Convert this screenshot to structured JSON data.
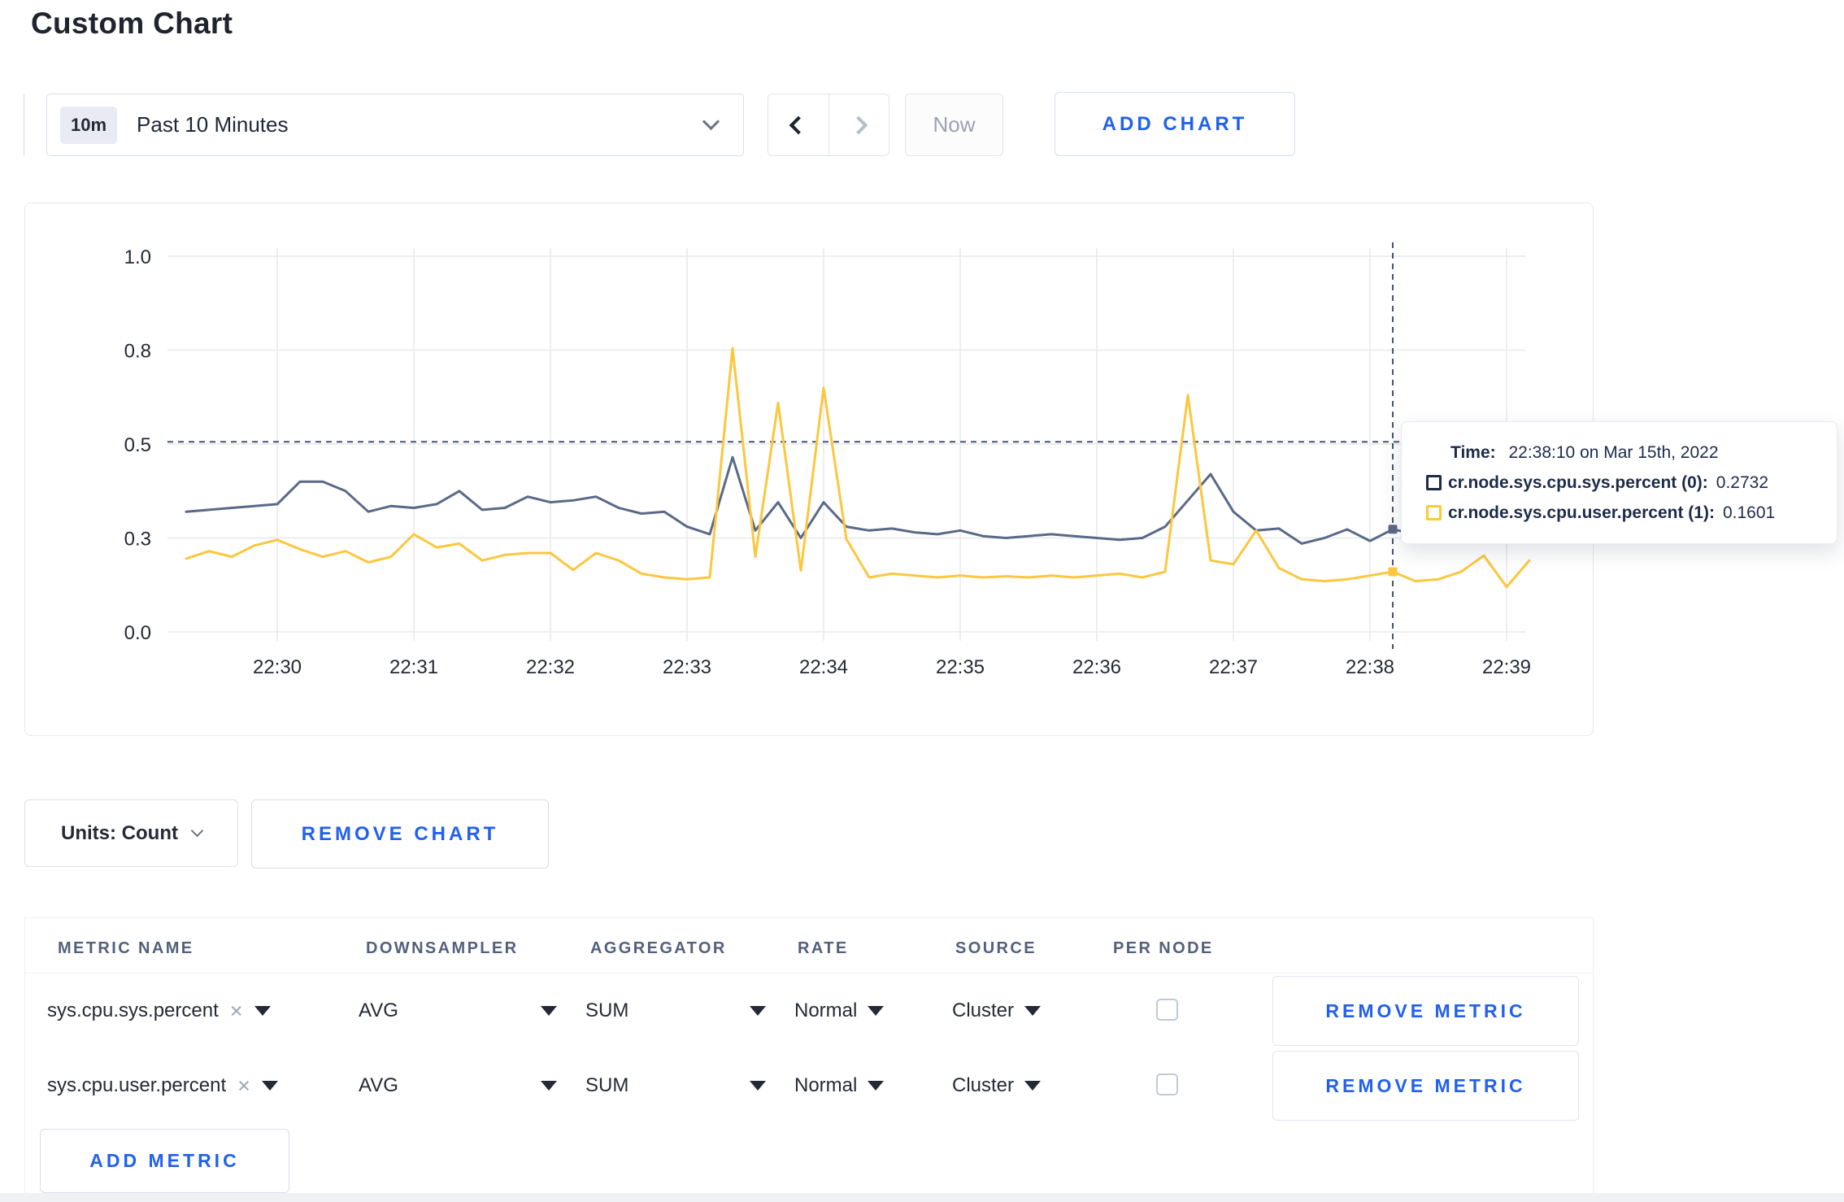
{
  "page": {
    "title": "Custom Chart"
  },
  "toolbar": {
    "time_window_badge": "10m",
    "time_window_label": "Past 10 Minutes",
    "now_label": "Now",
    "add_chart_label": "ADD CHART"
  },
  "units_selector": {
    "label": "Units: Count"
  },
  "remove_chart_label": "REMOVE CHART",
  "tooltip": {
    "time_label": "Time:",
    "time_value": "22:38:10 on Mar 15th, 2022",
    "series": [
      {
        "label": "cr.node.sys.cpu.sys.percent (0):",
        "value": "0.2732",
        "swatch": "#1d2b4a"
      },
      {
        "label": "cr.node.sys.cpu.user.percent (1):",
        "value": "0.1601",
        "swatch": "#ffc938"
      }
    ]
  },
  "chart_data": {
    "type": "line",
    "title": "",
    "xlabel": "",
    "ylabel": "",
    "ylim": [
      0,
      1
    ],
    "grid": true,
    "x_ticks": [
      "22:30",
      "22:31",
      "22:32",
      "22:33",
      "22:34",
      "22:35",
      "22:36",
      "22:37",
      "22:38",
      "22:39"
    ],
    "y_ticks": [
      {
        "label": "0.0",
        "value": 0
      },
      {
        "label": "0.3",
        "value": 0.25
      },
      {
        "label": "0.5",
        "value": 0.5
      },
      {
        "label": "0.8",
        "value": 0.75
      },
      {
        "label": "1.0",
        "value": 1
      }
    ],
    "start_time": "22:29:20",
    "step_seconds": 10,
    "series": [
      {
        "name": "cr.node.sys.cpu.sys.percent",
        "color": "#5a6988",
        "values": [
          0.32,
          0.325,
          0.33,
          0.335,
          0.34,
          0.4,
          0.4,
          0.375,
          0.32,
          0.335,
          0.33,
          0.34,
          0.375,
          0.325,
          0.33,
          0.36,
          0.345,
          0.35,
          0.36,
          0.33,
          0.315,
          0.32,
          0.28,
          0.26,
          0.465,
          0.27,
          0.345,
          0.25,
          0.345,
          0.28,
          0.27,
          0.275,
          0.265,
          0.26,
          0.27,
          0.255,
          0.25,
          0.255,
          0.26,
          0.255,
          0.25,
          0.245,
          0.25,
          0.28,
          0.35,
          0.42,
          0.32,
          0.27,
          0.275,
          0.235,
          0.25,
          0.273,
          0.242,
          0.2732,
          0.26,
          0.27,
          0.25,
          0.26,
          0.26,
          0.26
        ]
      },
      {
        "name": "cr.node.sys.cpu.user.percent",
        "color": "#fcc73e",
        "values": [
          0.195,
          0.215,
          0.2,
          0.23,
          0.245,
          0.22,
          0.2,
          0.215,
          0.185,
          0.2,
          0.26,
          0.225,
          0.235,
          0.19,
          0.205,
          0.21,
          0.21,
          0.165,
          0.21,
          0.19,
          0.155,
          0.145,
          0.14,
          0.145,
          0.755,
          0.2,
          0.61,
          0.163,
          0.65,
          0.247,
          0.145,
          0.155,
          0.15,
          0.145,
          0.15,
          0.145,
          0.148,
          0.145,
          0.15,
          0.145,
          0.15,
          0.155,
          0.145,
          0.16,
          0.63,
          0.19,
          0.18,
          0.27,
          0.17,
          0.14,
          0.135,
          0.14,
          0.15,
          0.1601,
          0.135,
          0.14,
          0.16,
          0.203,
          0.12,
          0.19
        ]
      }
    ],
    "hover": {
      "time": "22:38:10",
      "values": [
        0.2732,
        0.1601
      ],
      "value_line": 0.506
    },
    "legend_position": "tooltip"
  },
  "metrics_table": {
    "headers": [
      "METRIC NAME",
      "DOWNSAMPLER",
      "AGGREGATOR",
      "RATE",
      "SOURCE",
      "PER NODE"
    ],
    "rows": [
      {
        "name": "sys.cpu.sys.percent",
        "downsampler": "AVG",
        "aggregator": "SUM",
        "rate": "Normal",
        "source": "Cluster",
        "per_node_checked": false
      },
      {
        "name": "sys.cpu.user.percent",
        "downsampler": "AVG",
        "aggregator": "SUM",
        "rate": "Normal",
        "source": "Cluster",
        "per_node_checked": false
      }
    ],
    "remove_metric_label": "REMOVE METRIC",
    "add_metric_label": "ADD METRIC"
  },
  "icons": {
    "clear": "×"
  },
  "colors": {
    "accent_blue": "#2160ef",
    "series_sys": "#5a6988",
    "series_user": "#fcc73e",
    "crosshair": "#46546f",
    "gridline": "#e8e9ee"
  }
}
